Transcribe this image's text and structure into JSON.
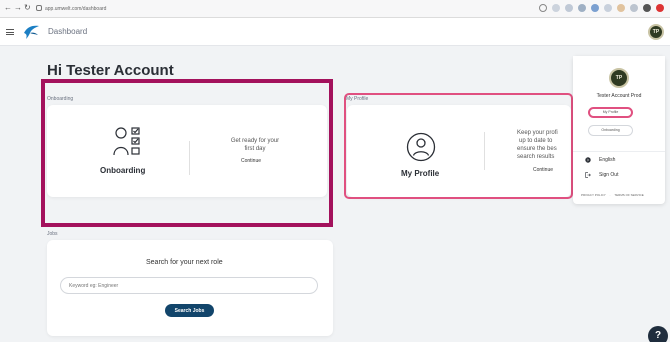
{
  "browser": {
    "url": "app.umwelt.com/dashboard"
  },
  "app": {
    "title": "Dashboard",
    "avatar_initials": "TP"
  },
  "greeting": "Hi Tester Account",
  "onboarding": {
    "section_label": "Onboarding",
    "card_title": "Onboarding",
    "subtitle_line1": "Get ready for your",
    "subtitle_line2": "first day",
    "link": "Continue"
  },
  "profile": {
    "section_label": "My Profile",
    "card_title": "My Profile",
    "subtitle_line1": "Keep your profi",
    "subtitle_line2": "up to date to",
    "subtitle_line3": "ensure the bes",
    "subtitle_line4": "search results",
    "link": "Continue"
  },
  "jobs": {
    "section_label": "Jobs",
    "title": "Search for your next role",
    "placeholder": "Keyword eg: Engineer",
    "button": "Search Jobs"
  },
  "panel": {
    "avatar_initials": "TP",
    "name": "Tester Account Prod",
    "my_profile": "My Profile",
    "onboarding": "Onboarding",
    "language": "English",
    "sign_out": "Sign Out",
    "privacy": "PRIVACY POLICY",
    "separator": "·",
    "terms": "TERMS OF SERVICE"
  },
  "help": "?",
  "colors": {
    "highlight_primary": "#a3115c",
    "highlight_secondary": "#e05080",
    "button": "#12456b",
    "logo": "#1c7fc4"
  }
}
